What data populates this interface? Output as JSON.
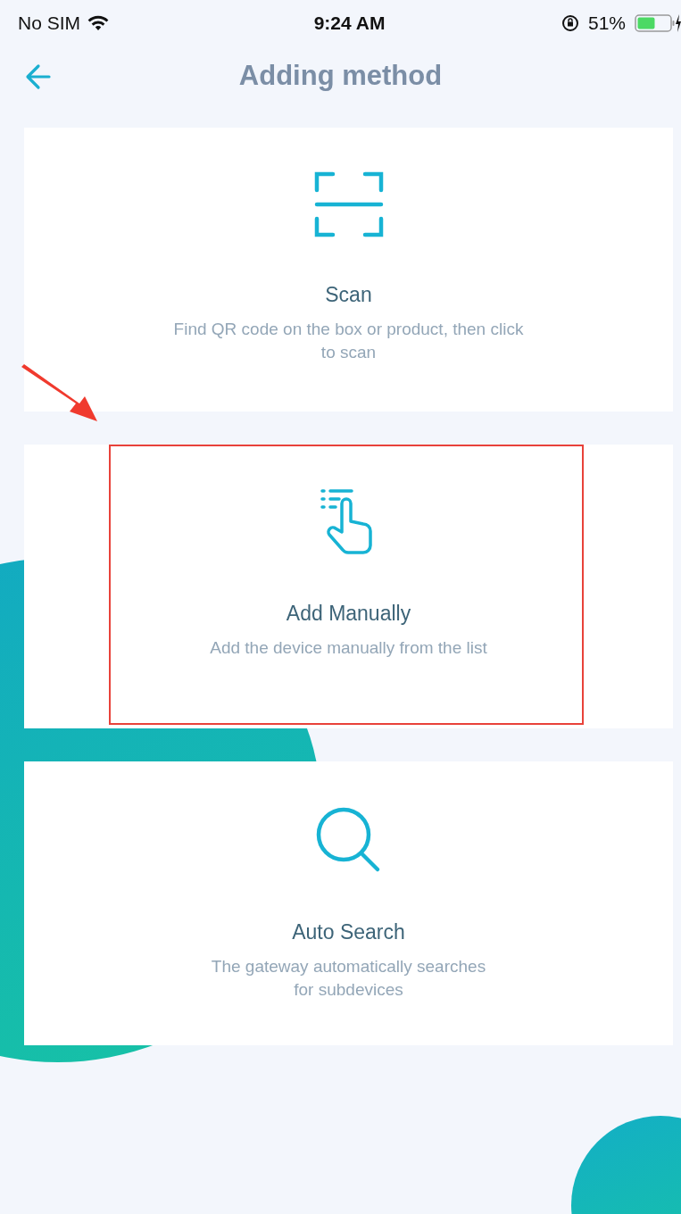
{
  "status_bar": {
    "carrier": "No SIM",
    "time": "9:24 AM",
    "battery": "51%"
  },
  "header": {
    "title": "Adding method"
  },
  "methods": [
    {
      "kind": "scan",
      "title": "Scan",
      "description_lines": [
        "Find QR code on the box or product, then click",
        "to scan"
      ],
      "highlighted": false
    },
    {
      "kind": "manual",
      "title": "Add Manually",
      "description_lines": [
        "Add the device manually from the list"
      ],
      "highlighted": true
    },
    {
      "kind": "search",
      "title": "Auto Search",
      "description_lines": [
        "The gateway automatically searches",
        "for subdevices"
      ],
      "highlighted": false
    }
  ]
}
